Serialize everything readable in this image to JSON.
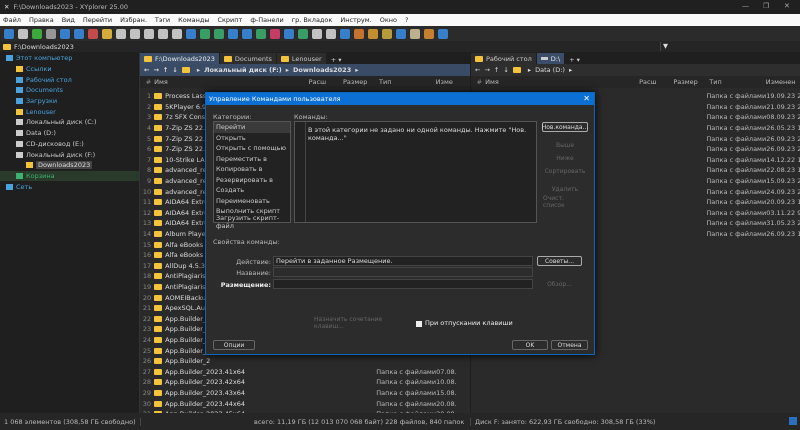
{
  "window": {
    "title": "F:\\Downloads2023 - XYplorer 25.00",
    "minimize": "—",
    "maximize": "❐",
    "close": "✕"
  },
  "menu": [
    "Файл",
    "Правка",
    "Вид",
    "Перейти",
    "Избран.",
    "Тэги",
    "Команды",
    "Скрипт",
    "ф-Панели",
    "гр. Вкладок",
    "Инструм.",
    "Окно",
    "?"
  ],
  "address": {
    "path": "F:\\Downloads2023"
  },
  "tree": [
    {
      "label": "Этот компьютер",
      "color": "#4aa3df",
      "indent": 0,
      "icon": "computer-icon"
    },
    {
      "label": "Ссылки",
      "color": "#4aa3df",
      "indent": 1,
      "icon": "folder-icon"
    },
    {
      "label": "Рабочий стол",
      "color": "#4aa3df",
      "indent": 1,
      "icon": "desktop-icon"
    },
    {
      "label": "Documents",
      "color": "#4aa3df",
      "indent": 1,
      "icon": "documents-icon"
    },
    {
      "label": "Загрузки",
      "color": "#4aa3df",
      "indent": 1,
      "icon": "download-icon"
    },
    {
      "label": "Lenouser",
      "color": "#4aa3df",
      "indent": 1,
      "icon": "folder-icon"
    },
    {
      "label": "Локальный диск (C:)",
      "color": "#ccc",
      "indent": 1,
      "icon": "drive-icon"
    },
    {
      "label": "Data (D:)",
      "color": "#ccc",
      "indent": 1,
      "icon": "drive-icon"
    },
    {
      "label": "CD-дисковод (E:)",
      "color": "#ccc",
      "indent": 1,
      "icon": "cd-drive-icon"
    },
    {
      "label": "Локальный диск (F:)",
      "color": "#ccc",
      "indent": 1,
      "icon": "drive-icon"
    },
    {
      "label": "Downloads2023",
      "color": "#ddd",
      "indent": 2,
      "icon": "folder-icon",
      "selected": true
    },
    {
      "label": "Корзина",
      "color": "#3cb371",
      "indent": 1,
      "icon": "recycle-bin-icon",
      "highlight": true
    },
    {
      "label": "Сеть",
      "color": "#4aa3df",
      "indent": 0,
      "icon": "network-icon"
    }
  ],
  "left_pane": {
    "tabs": [
      "F:\\Downloads2023",
      "Documents",
      "Lenouser"
    ],
    "breadcrumb": [
      "Локальный диск (F:)",
      "Downloads2023"
    ],
    "columns": {
      "num": "#",
      "name": "Имя",
      "ext": "Расш",
      "size": "Размер",
      "type": "Тип",
      "date": "Изме"
    },
    "rows": [
      {
        "n": "1",
        "name": "Process Lasso"
      },
      {
        "n": "2",
        "name": "5KPlayer 6.9"
      },
      {
        "n": "3",
        "name": "7z SFX Constr"
      },
      {
        "n": "4",
        "name": "7-Zip ZS 22.01"
      },
      {
        "n": "5",
        "name": "7-Zip ZS 22.01"
      },
      {
        "n": "6",
        "name": "7-Zip ZS 22.01"
      },
      {
        "n": "7",
        "name": "10-Strike LAN"
      },
      {
        "n": "8",
        "name": "advanced_ren"
      },
      {
        "n": "9",
        "name": "advanced_ren"
      },
      {
        "n": "10",
        "name": "advanced_ren"
      },
      {
        "n": "11",
        "name": "AIDA64 Extre"
      },
      {
        "n": "12",
        "name": "AIDA64 Extre"
      },
      {
        "n": "13",
        "name": "AIDA64 Extre"
      },
      {
        "n": "14",
        "name": "Album Player"
      },
      {
        "n": "15",
        "name": "Alfa eBooks M"
      },
      {
        "n": "16",
        "name": "Alfa eBooks M"
      },
      {
        "n": "17",
        "name": "AllDup 4.5.37"
      },
      {
        "n": "18",
        "name": "AntiPlagiarism"
      },
      {
        "n": "19",
        "name": "AntiPlagiarism"
      },
      {
        "n": "20",
        "name": "AOMEIBackup"
      },
      {
        "n": "21",
        "name": "ApexSQL.Aud"
      },
      {
        "n": "22",
        "name": "App.Builder_2"
      },
      {
        "n": "23",
        "name": "App.Builder_2"
      },
      {
        "n": "24",
        "name": "App.Builder_2"
      },
      {
        "n": "25",
        "name": "App.Builder_2"
      },
      {
        "n": "26",
        "name": "App.Builder_2"
      },
      {
        "n": "27",
        "name": "App.Builder_2023.41x64",
        "type": "Папка с файлами",
        "date": "07.08."
      },
      {
        "n": "28",
        "name": "App.Builder_2023.42x64",
        "type": "Папка с файлами",
        "date": "10.08."
      },
      {
        "n": "29",
        "name": "App.Builder_2023.43x64",
        "type": "Папка с файлами",
        "date": "15.08."
      },
      {
        "n": "30",
        "name": "App.Builder_2023.44x64",
        "type": "Папка с файлами",
        "date": "20.08."
      },
      {
        "n": "31",
        "name": "App.Builder_2023.45x64",
        "type": "Папка с файлами",
        "date": "20.08."
      }
    ]
  },
  "right_pane": {
    "tabs": [
      "Рабочий стол",
      "D:\\"
    ],
    "breadcrumb": [
      "Data (D:)"
    ],
    "columns": {
      "num": "#",
      "name": "Имя",
      "ext": "Расш",
      "size": "Размер",
      "type": "Тип",
      "date": "Изменен"
    },
    "rows": [
      {
        "type": "Папка с файлами",
        "date": "19.09.23 2"
      },
      {
        "type": "Папка с файлами",
        "date": "21.09.23 2"
      },
      {
        "type": "Папка с файлами",
        "date": "08.09.23 2"
      },
      {
        "type": "Папка с файлами",
        "date": "26.05.23 1"
      },
      {
        "type": "Папка с файлами",
        "date": "26.09.23 2"
      },
      {
        "type": "Папка с файлами",
        "date": "26.09.23 2"
      },
      {
        "type": "Папка с файлами",
        "date": "14.12.22 1"
      },
      {
        "type": "Папка с файлами",
        "date": "22.08.23 1"
      },
      {
        "type": "Папка с файлами",
        "date": "15.09.23 2"
      },
      {
        "type": "Папка с файлами",
        "date": "24.09.23 2"
      },
      {
        "type": "Папка с файлами",
        "date": "20.09.23 1"
      },
      {
        "type": "Папка с файлами",
        "date": "03.11.22 9"
      },
      {
        "type": "Папка с файлами",
        "date": "31.05.23 2"
      },
      {
        "type": "Папка с файлами",
        "date": "26.09.23 1"
      }
    ]
  },
  "status": {
    "items": "1 068 элементов (308,58 ГБ свободно)",
    "total": "всего: 11,19 ГБ (12 013 070 068 байт)  228 файлов, 840 папок",
    "disk": "Диск F:  занято: 622,93 ГБ   свободно: 308,58 ГБ (33%)"
  },
  "dialog": {
    "title": "Управление Командами пользователя",
    "categories_label": "Категории:",
    "commands_label": "Команды:",
    "categories": [
      "Перейти",
      "Открыть",
      "Открыть с помощью",
      "Переместить в",
      "Копировать в",
      "Резервировать в",
      "Создать",
      "Переименовать",
      "Выполнить скрипт",
      "Загрузить скрипт-файл"
    ],
    "empty_message": "В этой категории не задано ни одной команды. Нажмите \"Нов. команда...\"",
    "buttons": {
      "new": "Нов.команда...",
      "up": "Выше",
      "down": "Ниже",
      "sort": "Сортировать",
      "delete": "Удалить",
      "clear": "Очист. список",
      "tips": "Советы...",
      "browse": "Обзор...",
      "hotkey": "Назначить сочетание клавиш...",
      "options": "Опции",
      "ok": "OK",
      "cancel": "Отмена"
    },
    "properties_label": "Свойства команды:",
    "action_label": "Действие:",
    "action_value": "Перейти в заданное Размещение.",
    "name_label": "Название:",
    "name_value": "",
    "location_label": "Размещение:",
    "location_value": "",
    "on_release_label": "При отпускании клавиши",
    "on_release_checked": false
  }
}
